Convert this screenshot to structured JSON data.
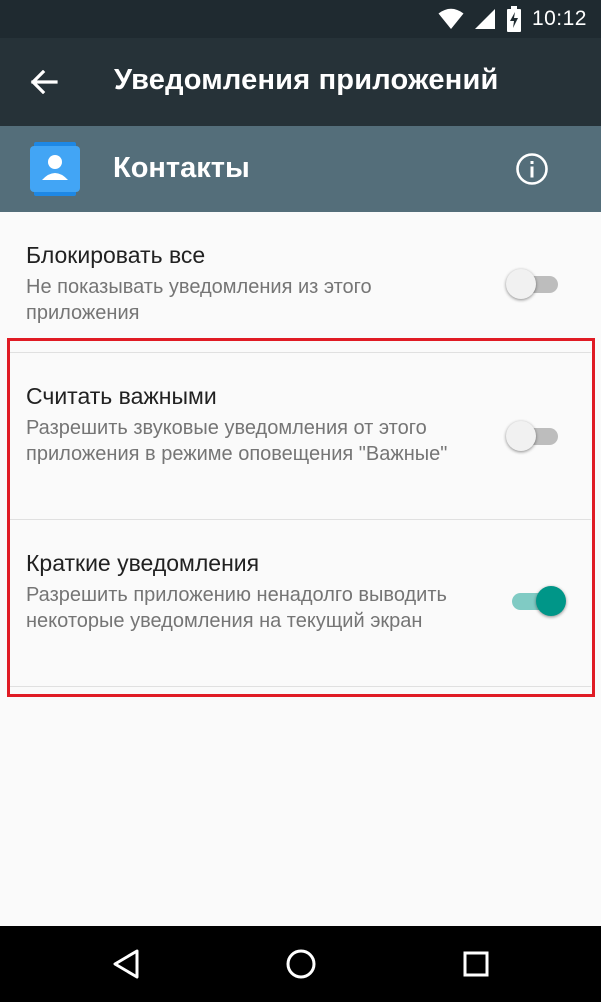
{
  "status_bar": {
    "time": "10:12",
    "icons": [
      "wifi-icon",
      "signal-icon",
      "battery-charging-icon"
    ]
  },
  "toolbar": {
    "back_icon": "arrow-left-icon",
    "title": "Уведомления приложений"
  },
  "app_header": {
    "app_icon": "contacts-app-icon",
    "app_name": "Контакты",
    "info_icon": "info-icon"
  },
  "settings": [
    {
      "title": "Блокировать все",
      "subtitle": "Не показывать уведомления из этого приложения",
      "enabled": false
    },
    {
      "title": "Считать важными",
      "subtitle": "Разрешить звуковые уведомления от этого приложения в режиме оповещения \"Важные\"",
      "enabled": false
    },
    {
      "title": "Краткие уведомления",
      "subtitle": "Разрешить приложению ненадолго выводить некоторые уведомления на текущий экран",
      "enabled": true
    }
  ],
  "colors": {
    "status_bar": "#1f2a30",
    "toolbar": "#263238",
    "app_header": "#546e7a",
    "accent": "#009688",
    "highlight": "#e01b24"
  },
  "nav_bar": {
    "buttons": [
      "back-triangle-icon",
      "home-circle-icon",
      "recents-square-icon"
    ]
  }
}
